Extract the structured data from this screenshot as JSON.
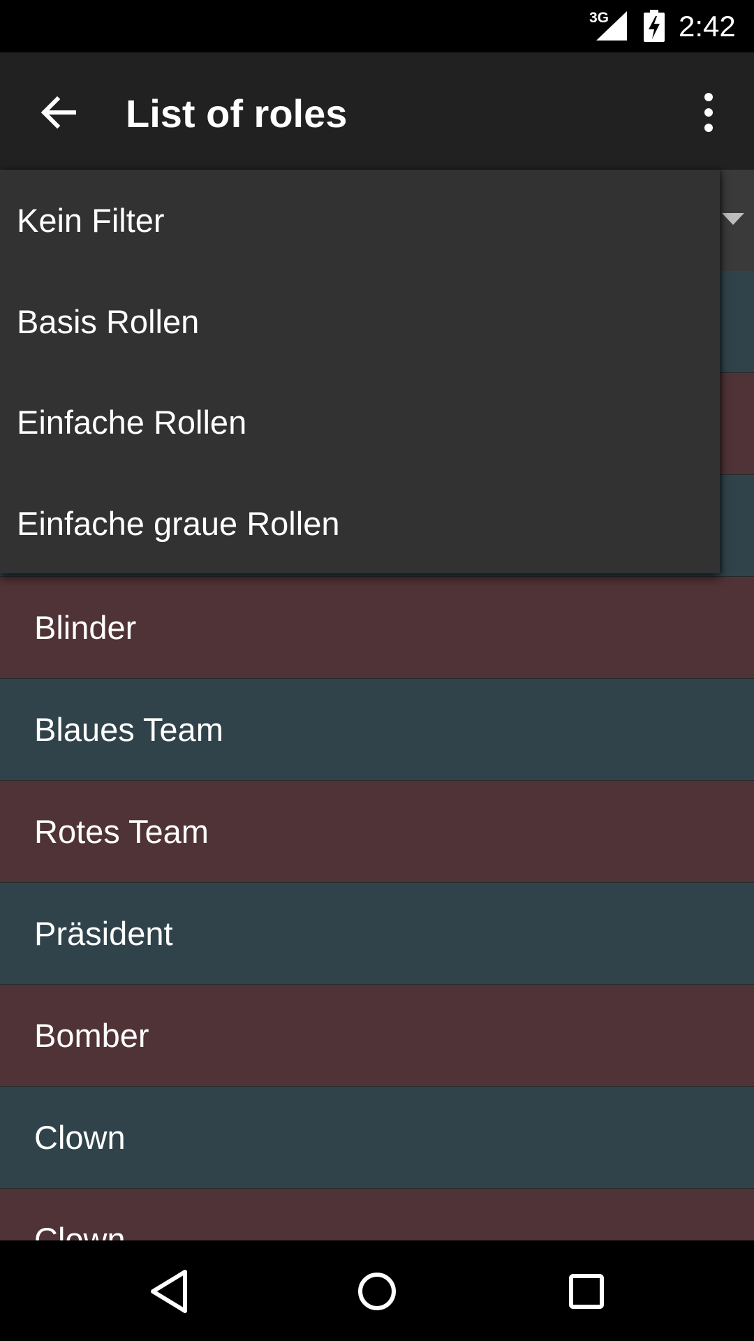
{
  "status_bar": {
    "network": "3G",
    "time": "2:42",
    "icons": [
      "signal-icon",
      "battery-charging-icon"
    ]
  },
  "app_bar": {
    "title": "List of roles",
    "icons": [
      "back-arrow-icon",
      "more-vert-icon"
    ]
  },
  "filter": {
    "icon": "dropdown-arrow-icon",
    "options": [
      {
        "label": "Kein Filter"
      },
      {
        "label": "Basis Rollen"
      },
      {
        "label": "Einfache Rollen"
      },
      {
        "label": "Einfache graue Rollen"
      }
    ]
  },
  "roles": [
    {
      "label": "",
      "team": "blue"
    },
    {
      "label": "",
      "team": "red"
    },
    {
      "label": "",
      "team": "blue"
    },
    {
      "label": "Blinder",
      "team": "red"
    },
    {
      "label": "Blaues Team",
      "team": "blue"
    },
    {
      "label": "Rotes Team",
      "team": "red"
    },
    {
      "label": "Präsident",
      "team": "blue"
    },
    {
      "label": "Bomber",
      "team": "red"
    },
    {
      "label": "Clown",
      "team": "blue"
    },
    {
      "label": "Clown",
      "team": "red"
    }
  ],
  "colors": {
    "blue_team": "#30434a",
    "red_team": "#503336",
    "dropdown_bg": "#323232",
    "app_bar_bg": "#212121"
  },
  "nav_bar": {
    "icons": [
      "nav-back-icon",
      "nav-home-icon",
      "nav-recents-icon"
    ]
  }
}
